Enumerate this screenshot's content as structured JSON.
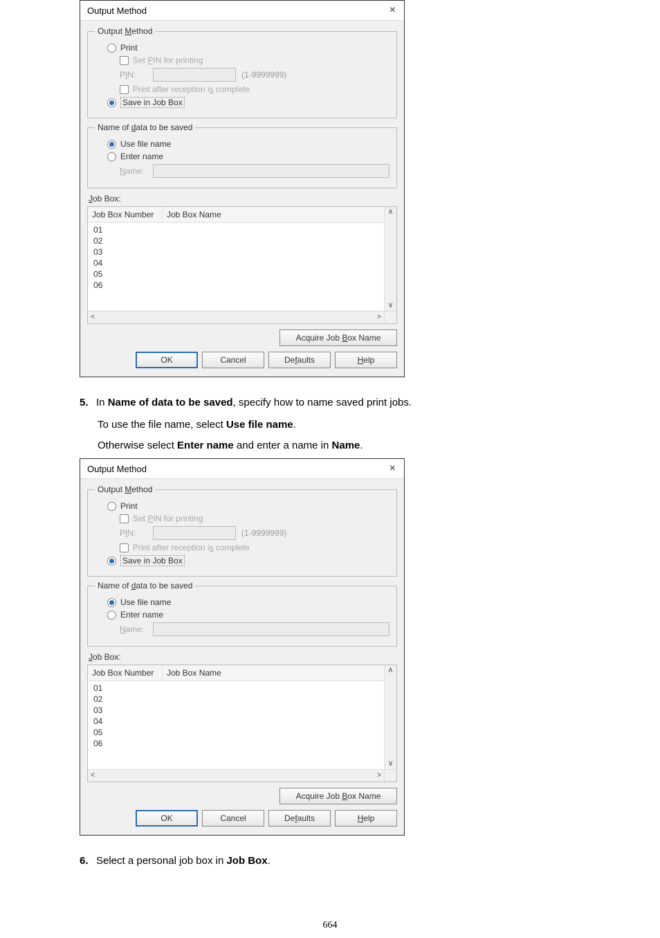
{
  "dialog": {
    "title": "Output Method",
    "close_glyph": "×",
    "group_output_method": "Output Method",
    "radio_print": "Print",
    "chk_set_pin": "Set PIN for printing",
    "pin_label": "PIN:",
    "pin_hint": "(1-9999999)",
    "chk_print_after": "Print after reception is complete",
    "radio_save": "Save in Job Box",
    "group_name_of_data": "Name of data to be saved",
    "radio_use_file": "Use file name",
    "radio_enter_name": "Enter name",
    "name_label": "Name:",
    "jobbox_label": "Job Box:",
    "col_number": "Job Box Number",
    "col_name": "Job Box Name",
    "rows": [
      "01",
      "02",
      "03",
      "04",
      "05",
      "06"
    ],
    "btn_acquire": "Acquire Job Box Name",
    "btn_ok": "OK",
    "btn_cancel": "Cancel",
    "btn_defaults": "Defaults",
    "btn_help": "Help",
    "mn_output_M": "M",
    "mn_pin_P": "P",
    "mn_pin_I": "I",
    "mn_after_s": "s",
    "mn_data_d": "d",
    "mn_name_N": "N",
    "mn_job_J": "J",
    "mn_box_B": "B",
    "mn_defaults_f": "f",
    "mn_help_H": "H"
  },
  "instructions": {
    "step5_num": "5.",
    "step5_pre": "In ",
    "step5_name": "Name of data to be saved",
    "step5_post": ", specify how to name saved print jobs.",
    "step5_sub1_a": "To use the file name, select ",
    "step5_sub1_b": "Use file name",
    "step5_sub1_c": ".",
    "step5_sub2_a": "Otherwise select ",
    "step5_sub2_b": "Enter name",
    "step5_sub2_c": " and enter a name in ",
    "step5_sub2_d": "Name",
    "step5_sub2_e": ".",
    "step6_num": "6.",
    "step6_a": "Select a personal job box in ",
    "step6_b": "Job Box",
    "step6_c": "."
  },
  "page_number": "664",
  "scroll": {
    "up": "∧",
    "down": "∨",
    "left": "<",
    "right": ">"
  }
}
